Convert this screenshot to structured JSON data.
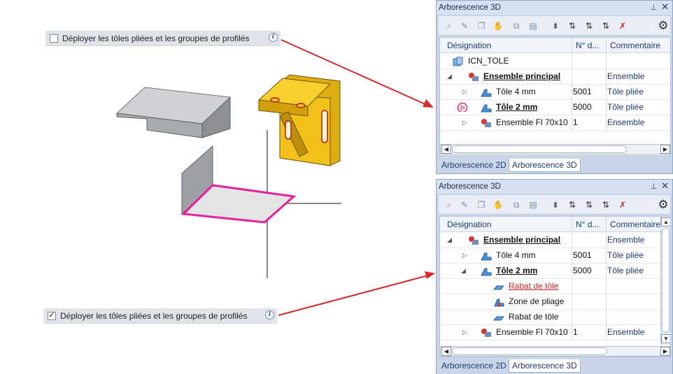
{
  "options": {
    "top_label": "Déployer les tôles pliées et les groupes de profilés",
    "top_checked": false,
    "bottom_label": "Déployer les tôles pliées et les groupes de profilés",
    "bottom_checked": true,
    "check_mark": "✓",
    "info_glyph": "i"
  },
  "panel_top": {
    "title": "Arborescence 3D",
    "pin": "⊥",
    "close": "✕",
    "columns": [
      "Désignation",
      "N° d...",
      "Commentaire"
    ],
    "rows": [
      {
        "name": "ICN_TOLE",
        "num": "",
        "comment": "",
        "icon": "folder-part-icon"
      },
      {
        "name": "Ensemble principal",
        "num": "",
        "comment": "Ensemble",
        "icon": "assembly-icon"
      },
      {
        "name": "Tôle 4 mm",
        "num": "5001",
        "comment": "Tôle pliée",
        "icon": "sheet-metal-icon"
      },
      {
        "name": "Tôle 2 mm",
        "num": "5000",
        "comment": "Tôle pliée",
        "icon": "sheet-metal-icon"
      },
      {
        "name": "Ensemble Fl 70x10",
        "num": "1",
        "comment": "Ensemble",
        "icon": "assembly-icon"
      }
    ],
    "tabs": [
      "Arborescence 2D",
      "Arborescence 3D"
    ],
    "active_tab": "Arborescence 3D"
  },
  "panel_bottom": {
    "title": "Arborescence 3D",
    "pin": "⊥",
    "close": "✕",
    "columns": [
      "Désignation",
      "N° d...",
      "Commentaire"
    ],
    "rows": [
      {
        "name": "Ensemble principal",
        "num": "",
        "comment": "Ensemble",
        "icon": "assembly-icon"
      },
      {
        "name": "Tôle 4 mm",
        "num": "5001",
        "comment": "Tôle pliée",
        "icon": "sheet-metal-icon"
      },
      {
        "name": "Tôle 2 mm",
        "num": "5000",
        "comment": "Tôle pliée",
        "icon": "sheet-metal-icon"
      },
      {
        "name": "Rabat de tôle",
        "num": "",
        "comment": "",
        "icon": "flange-icon"
      },
      {
        "name": "Zone de pliage",
        "num": "",
        "comment": "",
        "icon": "bend-zone-icon"
      },
      {
        "name": "Rabat de tôle",
        "num": "",
        "comment": "",
        "icon": "flange-icon"
      },
      {
        "name": "Ensemble Fl 70x10",
        "num": "1",
        "comment": "Ensemble",
        "icon": "assembly-icon"
      }
    ],
    "tabs": [
      "Arborescence 2D",
      "Arborescence 3D"
    ],
    "active_tab": "Arborescence 3D"
  },
  "colors": {
    "arrow": "#d42a2a",
    "highlight_magenta": "#e6209a",
    "part_yellow": "#f2c21a",
    "sheet_gray": "#b9bbbe",
    "panel_bg": "#c9d6e8",
    "header_text": "#1e3a6e"
  }
}
